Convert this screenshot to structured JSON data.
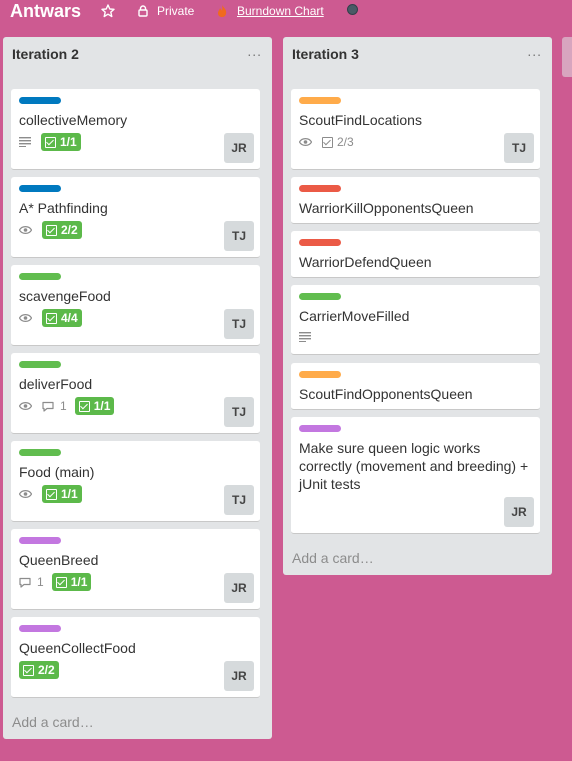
{
  "board": {
    "title": "Antwars",
    "visibility": "Private",
    "burndown_label": "Burndown Chart"
  },
  "colors": {
    "background": "#cd5a91",
    "label_blue": "#0079bf",
    "label_green": "#61bd4f",
    "label_orange": "#ffab4a",
    "label_red": "#eb5a46",
    "label_purple": "#c377e0",
    "checklist_complete": "#5cb94a"
  },
  "lists": [
    {
      "title": "Iteration 2",
      "menu": "...",
      "add_card": "Add a card…",
      "cards": [
        {
          "label": "label_blue",
          "title": "collectiveMemory",
          "description_icon": true,
          "checklist": "1/1",
          "member": "JR"
        },
        {
          "label": "label_blue",
          "title": "A* Pathfinding",
          "watch_icon": true,
          "checklist": "2/2",
          "member": "TJ"
        },
        {
          "label": "label_green",
          "title": "scavengeFood",
          "watch_icon": true,
          "checklist": "4/4",
          "member": "TJ"
        },
        {
          "label": "label_green",
          "title": "deliverFood",
          "watch_icon": true,
          "comments": "1",
          "checklist": "1/1",
          "member": "TJ"
        },
        {
          "label": "label_green",
          "title": "Food (main)",
          "watch_icon": true,
          "checklist": "1/1",
          "member": "TJ"
        },
        {
          "label": "label_purple",
          "title": "QueenBreed",
          "comments": "1",
          "checklist": "1/1",
          "member": "JR"
        },
        {
          "label": "label_purple",
          "title": "QueenCollectFood",
          "checklist": "2/2",
          "member": "JR"
        }
      ]
    },
    {
      "title": "Iteration 3",
      "menu": "...",
      "add_card": "Add a card…",
      "cards": [
        {
          "label": "label_orange",
          "title": "ScoutFindLocations",
          "watch_icon": true,
          "checklist": "2/3",
          "member": "TJ"
        },
        {
          "label": "label_red",
          "title": "WarriorKillOpponentsQueen"
        },
        {
          "label": "label_red",
          "title": "WarriorDefendQueen"
        },
        {
          "label": "label_green",
          "title": "CarrierMoveFilled",
          "description_icon": true
        },
        {
          "label": "label_orange",
          "title": "ScoutFindOpponentsQueen"
        },
        {
          "label": "label_purple",
          "title": "Make sure queen logic works correctly (movement and breeding) + jUnit tests",
          "member": "JR"
        }
      ]
    }
  ]
}
